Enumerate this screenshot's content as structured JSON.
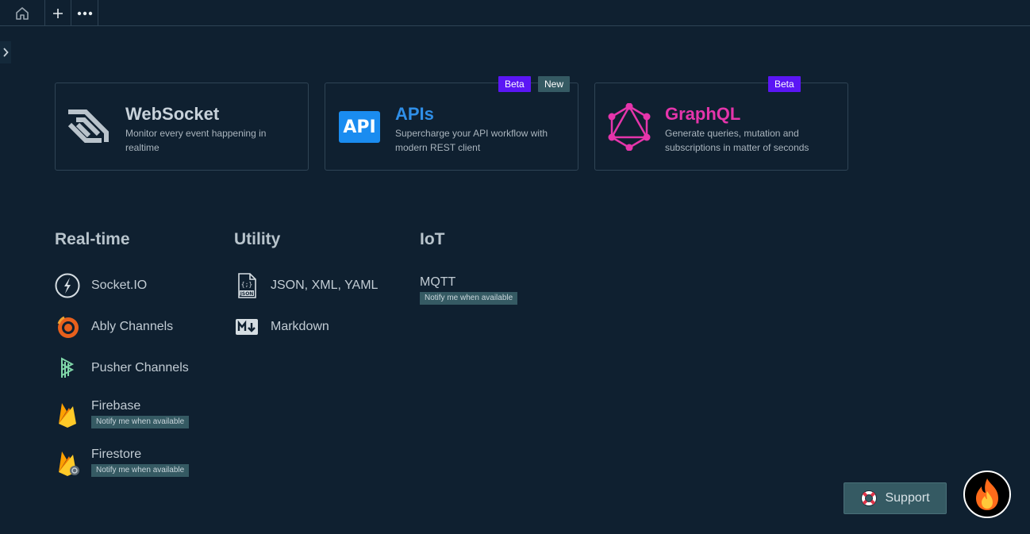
{
  "topbar": {
    "home_icon": "home-icon",
    "add_icon": "plus-icon",
    "more_icon": "more-icon",
    "add_label": "+",
    "more_label": "•••"
  },
  "sidebar": {
    "toggle_label": "❯"
  },
  "cards": [
    {
      "title": "WebSocket",
      "desc": "Monitor every event happening in realtime",
      "title_color": "#c8d2da",
      "badges": []
    },
    {
      "title": "APIs",
      "desc": "Supercharge your API workflow with modern REST client",
      "title_color": "#2f8fe8",
      "logo_text": "API",
      "badges": [
        "Beta",
        "New"
      ]
    },
    {
      "title": "GraphQL",
      "desc": "Generate queries, mutation and subscriptions in matter of seconds",
      "title_color": "#e535ab",
      "badges": [
        "Beta"
      ]
    }
  ],
  "sections": {
    "realtime": {
      "title": "Real-time",
      "items": [
        {
          "label": "Socket.IO"
        },
        {
          "label": "Ably Channels"
        },
        {
          "label": "Pusher Channels"
        },
        {
          "label": "Firebase",
          "notify": "Notify me when available"
        },
        {
          "label": "Firestore",
          "notify": "Notify me when available"
        }
      ]
    },
    "utility": {
      "title": "Utility",
      "items": [
        {
          "label": "JSON, XML, YAML"
        },
        {
          "label": "Markdown"
        }
      ]
    },
    "iot": {
      "title": "IoT",
      "items": [
        {
          "label": "MQTT",
          "notify": "Notify me when available"
        }
      ]
    }
  },
  "support": {
    "label": "Support"
  },
  "colors": {
    "background": "#0f2030",
    "beta": "#5b16f5",
    "new": "#355a63",
    "graphql": "#e535ab",
    "api": "#2f8fe8"
  }
}
